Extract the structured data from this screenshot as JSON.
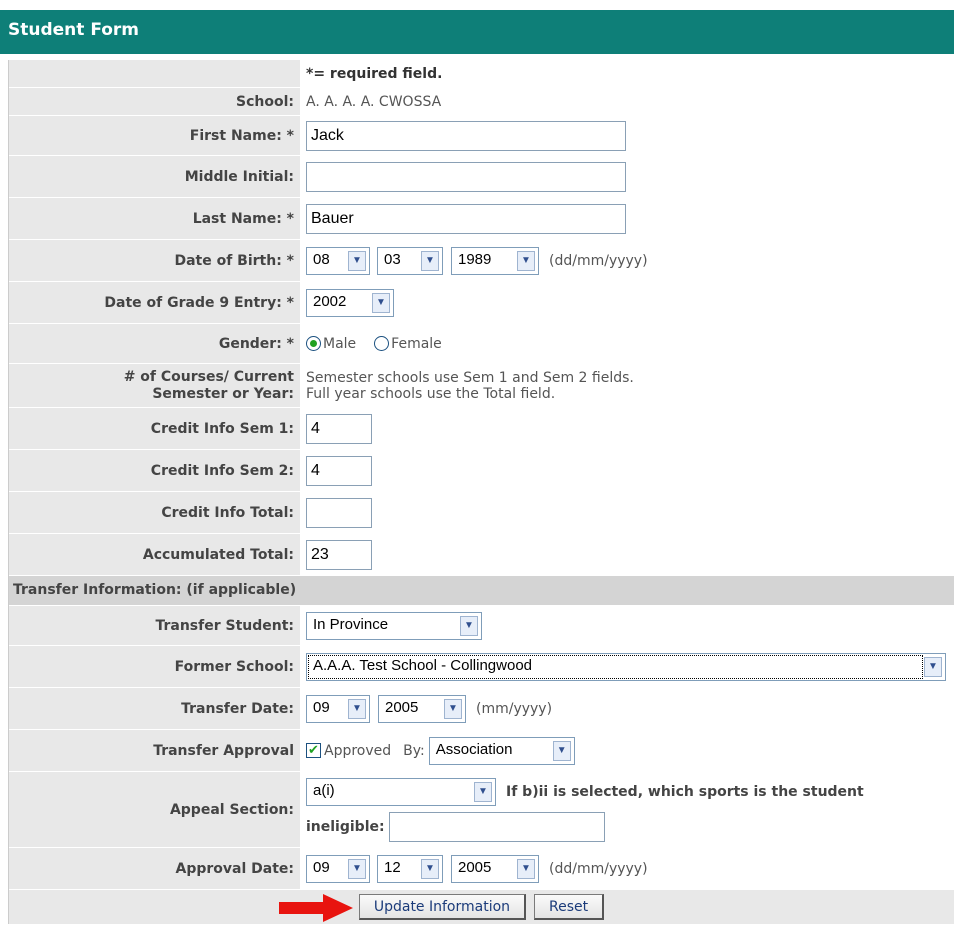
{
  "header": {
    "title": "Student Form"
  },
  "required_note": "*= required field.",
  "school": {
    "label": "School:",
    "value": "A. A. A. A. CWOSSA"
  },
  "first_name": {
    "label": "First Name: *",
    "value": "Jack"
  },
  "middle_initial": {
    "label": "Middle Initial:",
    "value": ""
  },
  "last_name": {
    "label": "Last Name: *",
    "value": "Bauer"
  },
  "dob": {
    "label": "Date of Birth: *",
    "day": "08",
    "month": "03",
    "year": "1989",
    "format": "(dd/mm/yyyy)"
  },
  "grade9": {
    "label": "Date of Grade 9 Entry: *",
    "year": "2002"
  },
  "gender": {
    "label": "Gender: *",
    "male": "Male",
    "female": "Female",
    "selected": "Male"
  },
  "courses": {
    "label_line1": "# of Courses/ Current",
    "label_line2": "Semester or Year:",
    "note_line1": "Semester schools use Sem 1 and Sem 2 fields.",
    "note_line2": "Full year schools use the Total field."
  },
  "credit_sem1": {
    "label": "Credit Info Sem 1:",
    "value": "4"
  },
  "credit_sem2": {
    "label": "Credit Info Sem 2:",
    "value": "4"
  },
  "credit_total": {
    "label": "Credit Info Total:",
    "value": ""
  },
  "accumulated_total": {
    "label": "Accumulated Total:",
    "value": "23"
  },
  "transfer_section": {
    "title": "Transfer Information: (if applicable)"
  },
  "transfer_student": {
    "label": "Transfer Student:",
    "value": "In Province"
  },
  "former_school": {
    "label": "Former School:",
    "value": "A.A.A. Test School - Collingwood"
  },
  "transfer_date": {
    "label": "Transfer Date:",
    "month": "09",
    "year": "2005",
    "format": "(mm/yyyy)"
  },
  "transfer_approval": {
    "label": "Transfer Approval",
    "checkbox_label": "Approved",
    "checked": true,
    "by_label": "By:",
    "by_value": "Association"
  },
  "appeal_section": {
    "label": "Appeal Section:",
    "value": "a(i)",
    "question": "If b)ii is selected, which sports is the student",
    "ineligible_label": "ineligible:",
    "ineligible_value": ""
  },
  "approval_date": {
    "label": "Approval Date:",
    "day": "09",
    "month": "12",
    "year": "2005",
    "format": "(dd/mm/yyyy)"
  },
  "buttons": {
    "update": "Update Information",
    "reset": "Reset"
  },
  "colors": {
    "header_bg": "#0e7f78",
    "label_bg": "#e8e8e8",
    "section_bg": "#d4d4d4",
    "arrow": "#e8140f"
  }
}
